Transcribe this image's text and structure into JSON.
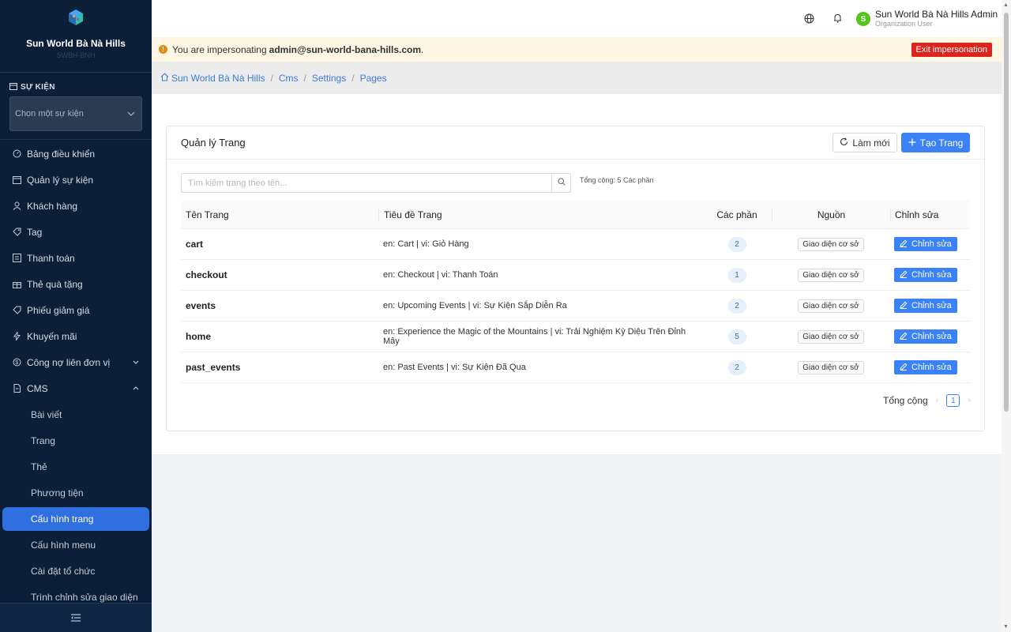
{
  "brand": {
    "name": "Sun World Bà Nà Hills",
    "sub": "SWBH-BNH"
  },
  "sidebar": {
    "event_label": "SỰ KIỆN",
    "event_placeholder": "Chọn một sự kiện",
    "items": [
      {
        "label": "Bảng điều khiển",
        "icon": "dashboard-icon"
      },
      {
        "label": "Quản lý sự kiện",
        "icon": "calendar-icon"
      },
      {
        "label": "Khách hàng",
        "icon": "user-icon"
      },
      {
        "label": "Tag",
        "icon": "tag-icon"
      },
      {
        "label": "Thanh toán",
        "icon": "payment-icon"
      },
      {
        "label": "Thẻ quà tặng",
        "icon": "gift-icon"
      },
      {
        "label": "Phiếu giảm giá",
        "icon": "coupon-icon"
      },
      {
        "label": "Khuyến mãi",
        "icon": "flash-icon"
      },
      {
        "label": "Công nợ liên đơn vị",
        "icon": "ledger-icon"
      },
      {
        "label": "CMS",
        "icon": "file-icon"
      }
    ],
    "cms_items": [
      {
        "label": "Bài viết"
      },
      {
        "label": "Trang"
      },
      {
        "label": "Thẻ"
      },
      {
        "label": "Phương tiện"
      },
      {
        "label": "Cấu hình trang"
      },
      {
        "label": "Cấu hình menu"
      },
      {
        "label": "Cài đặt tổ chức"
      },
      {
        "label": "Trình chỉnh sửa giao diện"
      }
    ]
  },
  "header": {
    "user_initial": "S",
    "user_name": "Sun World Bà Nà Hills Admin",
    "user_role": "Organization User"
  },
  "banner": {
    "text": "You are impersonating",
    "email": "admin@sun-world-bana-hills.com",
    "suffix": ".",
    "exit_label": "Exit impersonation"
  },
  "breadcrumb": [
    "Sun World Bà Nà Hills",
    "Cms",
    "Settings",
    "Pages"
  ],
  "card": {
    "title": "Quản lý Trang",
    "refresh_label": "Làm mới",
    "create_label": "Tạo Trang",
    "search_placeholder": "Tìm kiếm trang theo tên...",
    "total_text": "Tổng cộng: 5 Các phần"
  },
  "table": {
    "headers": [
      "Tên Trang",
      "Tiêu đề Trang",
      "Các phần",
      "Nguồn",
      "Chỉnh sửa"
    ],
    "rows": [
      {
        "name": "cart",
        "title": "en: Cart | vi: Giỏ Hàng",
        "sections": "2",
        "source": "Giao diện cơ sở",
        "edit": "Chỉnh sửa"
      },
      {
        "name": "checkout",
        "title": "en: Checkout | vi: Thanh Toán",
        "sections": "1",
        "source": "Giao diện cơ sở",
        "edit": "Chỉnh sửa"
      },
      {
        "name": "events",
        "title": "en: Upcoming Events | vi: Sự Kiện Sắp Diễn Ra",
        "sections": "2",
        "source": "Giao diện cơ sở",
        "edit": "Chỉnh sửa"
      },
      {
        "name": "home",
        "title": "en: Experience the Magic of the Mountains | vi: Trải Nghiệm Kỳ Diệu Trên Đỉnh Mây",
        "sections": "5",
        "source": "Giao diện cơ sở",
        "edit": "Chỉnh sửa"
      },
      {
        "name": "past_events",
        "title": "en: Past Events | vi: Sự Kiện Đã Qua",
        "sections": "2",
        "source": "Giao diện cơ sở",
        "edit": "Chỉnh sửa"
      }
    ]
  },
  "pagination": {
    "total_label": "Tổng cộng",
    "current_page": "1"
  },
  "colors": {
    "sidebar_bg": "#0b1f38",
    "accent": "#3b82f6",
    "danger": "#d9251d",
    "avatar": "#52c41a"
  }
}
